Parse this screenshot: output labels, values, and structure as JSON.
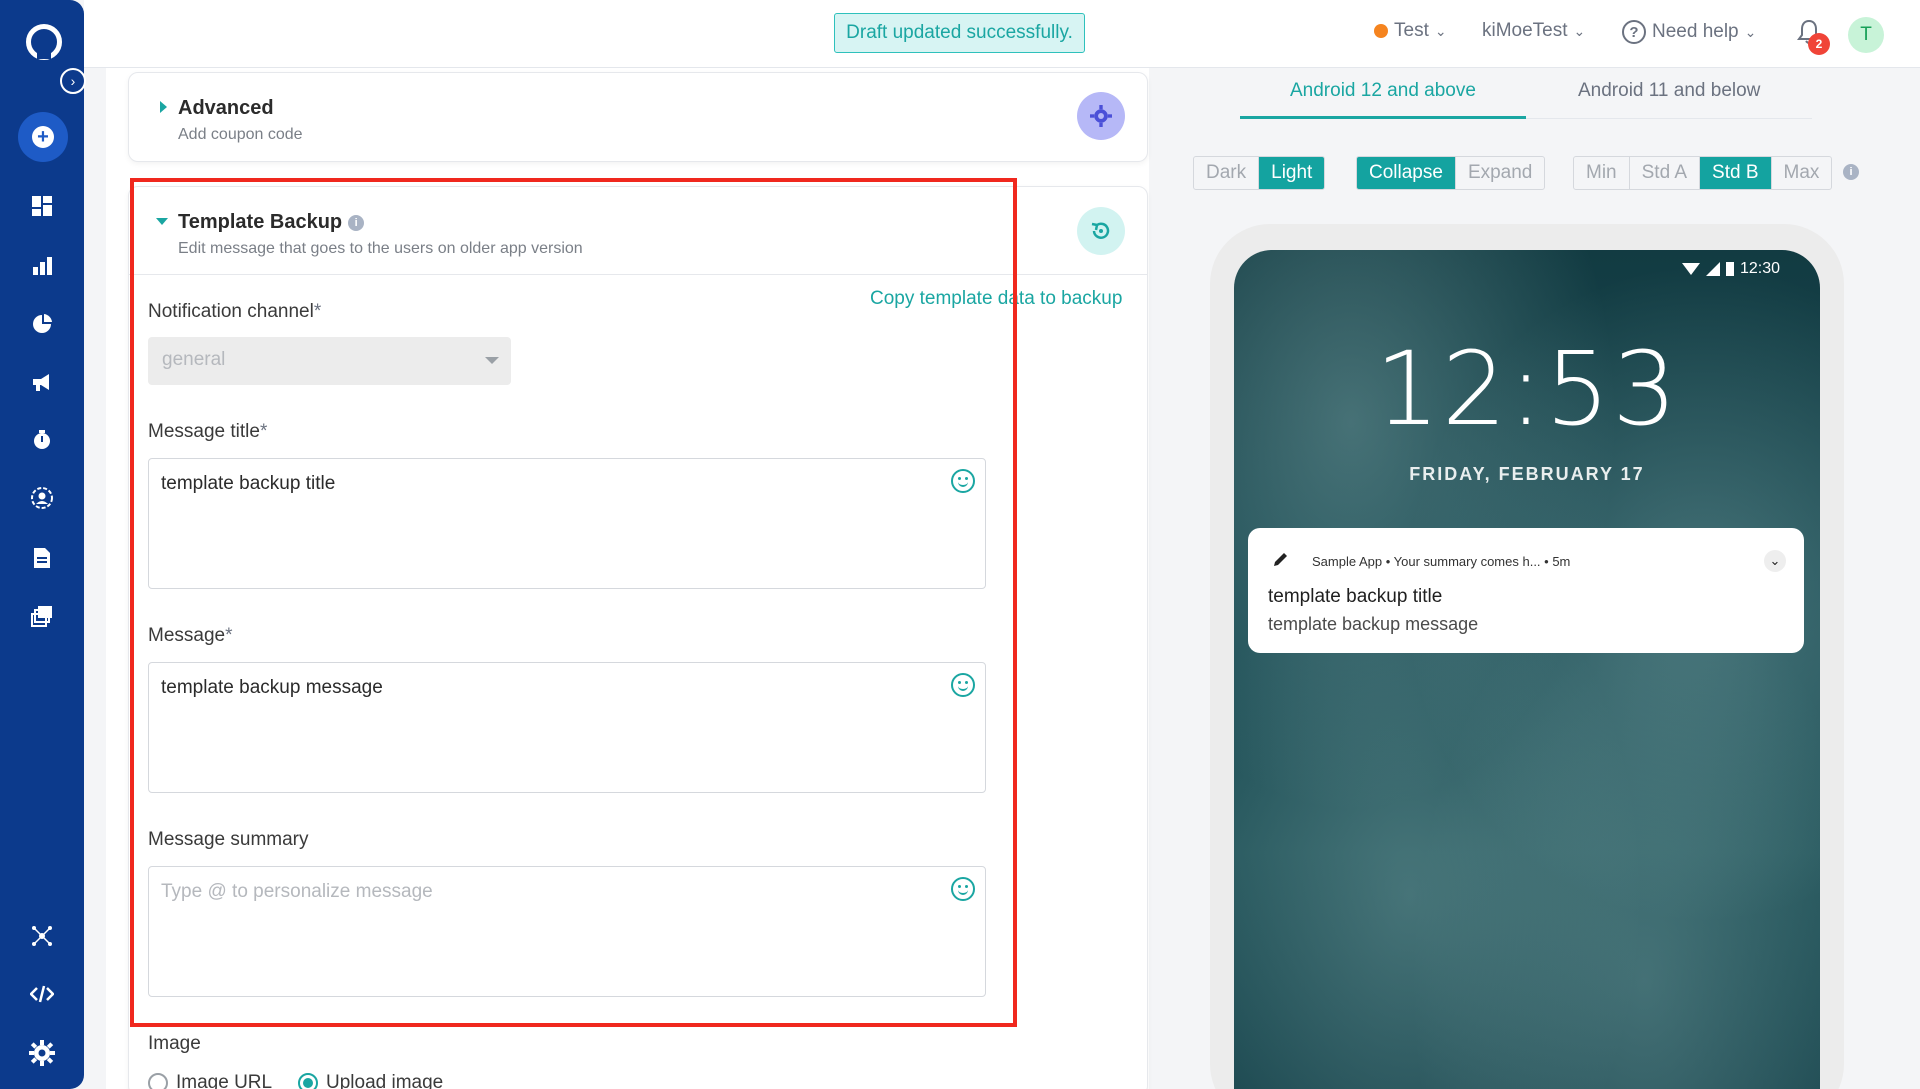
{
  "topbar": {
    "toast": "Draft updated successfully.",
    "project": "Test",
    "account": "kiMoeTest",
    "help": "Need help",
    "notification_count": "2",
    "avatar_initial": "T"
  },
  "advanced": {
    "title": "Advanced",
    "subtitle": "Add coupon code"
  },
  "template_backup": {
    "title": "Template Backup",
    "subtitle": "Edit message that goes to the users on older app version",
    "copy_link": "Copy template data to backup",
    "notification_channel": {
      "label": "Notification channel",
      "required": "*",
      "value": "general"
    },
    "message_title": {
      "label": "Message title",
      "required": "*",
      "value": "template backup title"
    },
    "message": {
      "label": "Message",
      "required": "*",
      "value": "template backup message"
    },
    "message_summary": {
      "label": "Message summary",
      "placeholder": "Type @ to personalize message"
    }
  },
  "image": {
    "label": "Image",
    "options": [
      "Image URL",
      "Upload image"
    ],
    "selected": "Upload image"
  },
  "preview": {
    "tabs": [
      "Android 12 and above",
      "Android 11 and below"
    ],
    "active_tab": "Android 12 and above",
    "theme": [
      "Dark",
      "Light"
    ],
    "theme_selected": "Light",
    "mode": [
      "Collapse",
      "Expand"
    ],
    "mode_selected": "Collapse",
    "size": [
      "Min",
      "Std A",
      "Std B",
      "Max"
    ],
    "size_selected": "Std B",
    "status_time": "12:30",
    "clock": "12:53",
    "date": "FRIDAY, FEBRUARY 17",
    "notification": {
      "header": "Sample App • Your summary comes h...   • 5m",
      "title": "template backup title",
      "message": "template backup message"
    }
  },
  "colors": {
    "sidebar": "#0c3a8c",
    "accent": "#1aa6a2",
    "highlight_box": "#f0281e"
  }
}
